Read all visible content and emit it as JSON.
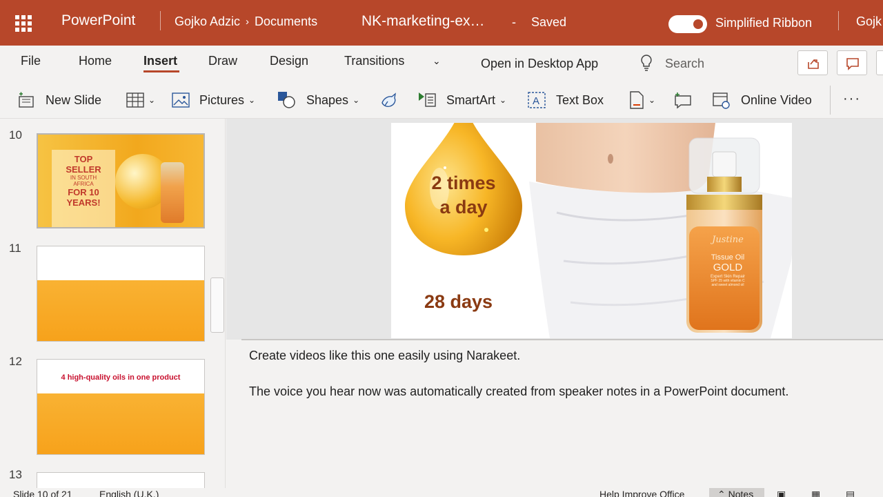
{
  "titlebar": {
    "app": "PowerPoint",
    "breadcrumb_user": "Gojko Adzic",
    "breadcrumb_folder": "Documents",
    "document": "NK-marketing-ex…",
    "separator": "-",
    "status": "Saved",
    "simplified_ribbon": "Simplified Ribbon",
    "simplified_ribbon_on": true,
    "user_short": "Gojk",
    "color": "#b7472a"
  },
  "tabs": {
    "items": [
      "File",
      "Home",
      "Insert",
      "Draw",
      "Design",
      "Transitions"
    ],
    "active": "Insert",
    "open_desktop": "Open in Desktop App",
    "search": "Search"
  },
  "ribbon": {
    "new_slide": "New Slide",
    "pictures": "Pictures",
    "shapes": "Shapes",
    "smartart": "SmartArt",
    "text_box": "Text Box",
    "online_video": "Online Video",
    "more": "···"
  },
  "thumbnails": [
    {
      "number": "10",
      "lines": [
        "TOP",
        "SELLER",
        "IN SOUTH",
        "AFRICA",
        "FOR 10",
        "YEARS!"
      ]
    },
    {
      "number": "11"
    },
    {
      "number": "12",
      "caption": "4 high-quality oils in one product"
    },
    {
      "number": "13"
    }
  ],
  "slide": {
    "drop_line1": "2 times",
    "drop_line2": "a day",
    "duration": "28 days",
    "product_brand": "Justine",
    "product_name1": "Tissue Oil",
    "product_name2": "GOLD",
    "product_desc1": "Expert Skin Repair",
    "product_desc2": "SPF 25 with vitamin C",
    "product_desc3": "and sweet almond oil"
  },
  "notes": {
    "line1": "Create videos like this one easily using Narakeet.",
    "line2": "The voice you hear now was automatically created from speaker notes in a PowerPoint document."
  },
  "statusbar": {
    "slide": "Slide 10 of 21",
    "language": "English (U.K.)",
    "help": "Help Improve Office",
    "notes": "Notes"
  }
}
